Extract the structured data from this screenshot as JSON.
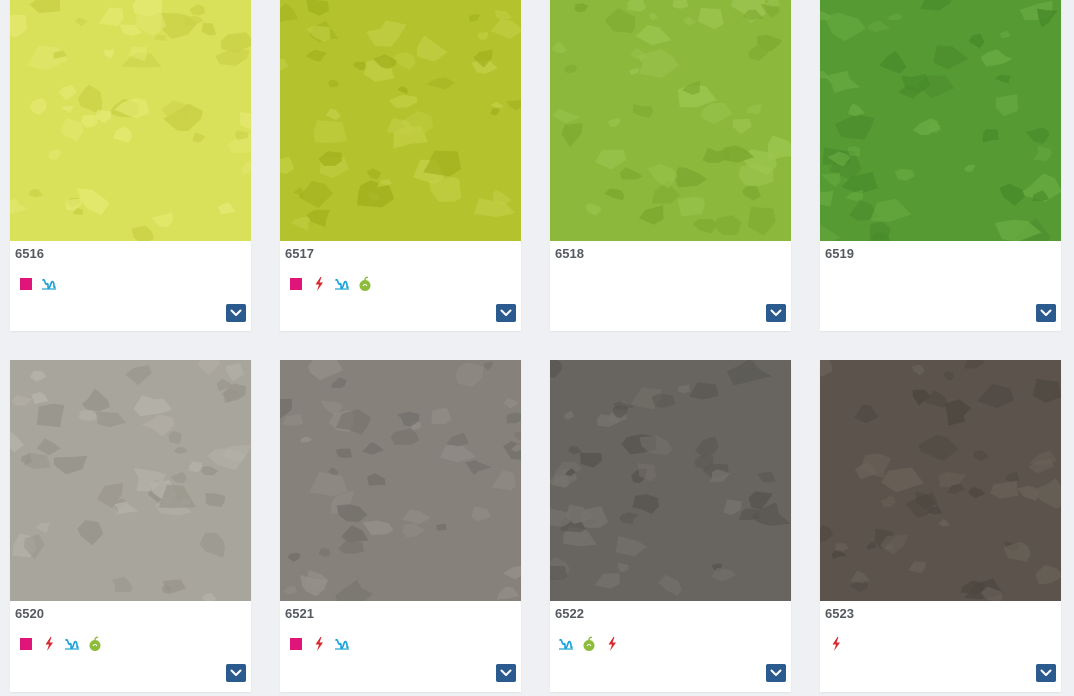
{
  "colors": {
    "page_bg": "#eef0f3",
    "expand_button": "#2a5a8e",
    "icon_square": "#e0157a",
    "icon_bolt": "#d9262e",
    "icon_heat": "#1aa0d8",
    "icon_eco": "#8dbb3a"
  },
  "products": [
    {
      "code": "6516",
      "swatch": {
        "base": "#d9e05a",
        "dark": "#c9d045",
        "light": "#e4ea72"
      },
      "icons": [
        "square-icon",
        "heat-icon"
      ]
    },
    {
      "code": "6517",
      "swatch": {
        "base": "#b4c22d",
        "dark": "#a2b01f",
        "light": "#c3cf45"
      },
      "icons": [
        "square-icon",
        "bolt-icon",
        "heat-icon",
        "eco-icon"
      ]
    },
    {
      "code": "6518",
      "swatch": {
        "base": "#8cb83c",
        "dark": "#7ca82f",
        "light": "#9cc650"
      },
      "icons": []
    },
    {
      "code": "6519",
      "swatch": {
        "base": "#569a34",
        "dark": "#488a2a",
        "light": "#68ab42"
      },
      "icons": []
    },
    {
      "code": "6520",
      "swatch": {
        "base": "#a8a59c",
        "dark": "#96938a",
        "light": "#b6b3aa"
      },
      "icons": [
        "square-icon",
        "bolt-icon",
        "heat-icon",
        "eco-icon"
      ]
    },
    {
      "code": "6521",
      "swatch": {
        "base": "#86817b",
        "dark": "#74706a",
        "light": "#95908a"
      },
      "icons": [
        "square-icon",
        "bolt-icon",
        "heat-icon"
      ]
    },
    {
      "code": "6522",
      "swatch": {
        "base": "#68645f",
        "dark": "#57544f",
        "light": "#76726d"
      },
      "icons": [
        "heat-icon",
        "eco-icon",
        "bolt-icon"
      ]
    },
    {
      "code": "6523",
      "swatch": {
        "base": "#5c544c",
        "dark": "#4d4640",
        "light": "#6a6259"
      },
      "icons": [
        "bolt-icon"
      ]
    }
  ]
}
